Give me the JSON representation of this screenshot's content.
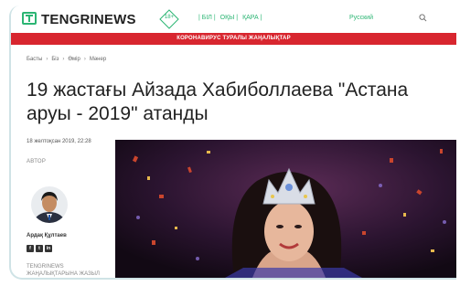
{
  "header": {
    "logo_text": "TENGRINEWS",
    "age_rating": "18+",
    "lang_nav": [
      "| БІЛ |",
      "ОҚЫ |",
      "ҚАРА |"
    ],
    "lang_ru": "Русский",
    "icons": {
      "logo": "tv-icon",
      "search": "search-icon"
    },
    "brand_color": "#2bb573"
  },
  "banner": {
    "text": "КОРОНАВИРУС ТУРАЛЫ ЖАҢАЛЫҚТАР",
    "color": "#d8262f"
  },
  "breadcrumb": [
    "Басты",
    "Біз",
    "Өмір",
    "Мәнер"
  ],
  "article": {
    "title": "19 жастағы Айзада Хабиболлаева \"Астана аруы - 2019\" атанды",
    "date": "18 желтоқсан 2019, 22:28",
    "author_label": "АВТОР",
    "author_name": "Ардақ Құлтаев",
    "socials": [
      "f",
      "t",
      "in"
    ],
    "promo": "TENGRINEWS ЖАҢАЛЫҚТАРЫНА ЖАЗЫЛ"
  }
}
